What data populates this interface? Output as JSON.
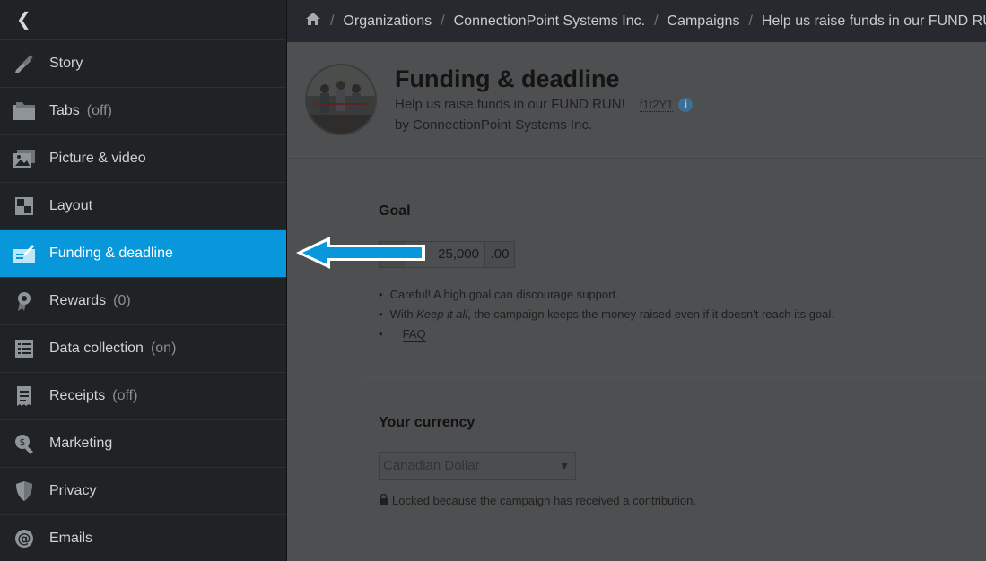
{
  "sidebar": {
    "back_icon": "chevron-left-icon",
    "items": [
      {
        "label": "Story",
        "suffix": "",
        "icon": "pencil-ruler-icon"
      },
      {
        "label": "Tabs",
        "suffix": "(off)",
        "icon": "folder-icon"
      },
      {
        "label": "Picture & video",
        "suffix": "",
        "icon": "images-icon"
      },
      {
        "label": "Layout",
        "suffix": "",
        "icon": "layout-icon"
      },
      {
        "label": "Funding & deadline",
        "suffix": "",
        "icon": "funding-icon",
        "active": true
      },
      {
        "label": "Rewards",
        "suffix": "(0)",
        "icon": "ribbon-icon"
      },
      {
        "label": "Data collection",
        "suffix": "(on)",
        "icon": "list-icon"
      },
      {
        "label": "Receipts",
        "suffix": "(off)",
        "icon": "receipt-icon"
      },
      {
        "label": "Marketing",
        "suffix": "",
        "icon": "search-dollar-icon"
      },
      {
        "label": "Privacy",
        "suffix": "",
        "icon": "shield-icon"
      },
      {
        "label": "Emails",
        "suffix": "",
        "icon": "at-icon"
      }
    ]
  },
  "breadcrumb": [
    "Organizations",
    "ConnectionPoint Systems Inc.",
    "Campaigns",
    "Help us raise funds in our FUND RUN!"
  ],
  "header": {
    "title": "Funding & deadline",
    "campaign_name": "Help us raise funds in our FUND RUN!",
    "campaign_code": "f1t2Y1",
    "byline": "by ConnectionPoint Systems Inc."
  },
  "goal": {
    "title": "Goal",
    "amount": "25,000",
    "decimals": ".00",
    "note1": "Careful! A high goal can discourage support.",
    "note2_prefix": "With ",
    "note2_em": "Keep it all",
    "note2_suffix": ", the campaign keeps the money raised even if it doesn't reach its goal.",
    "faq": "FAQ"
  },
  "currency": {
    "title": "Your currency",
    "selected": "Canadian Dollar",
    "locked_note": "Locked because the campaign has received a contribution."
  },
  "colors": {
    "accent": "#0797da",
    "sidebar_bg": "#1f2326",
    "overlay": "#4e4f50"
  }
}
